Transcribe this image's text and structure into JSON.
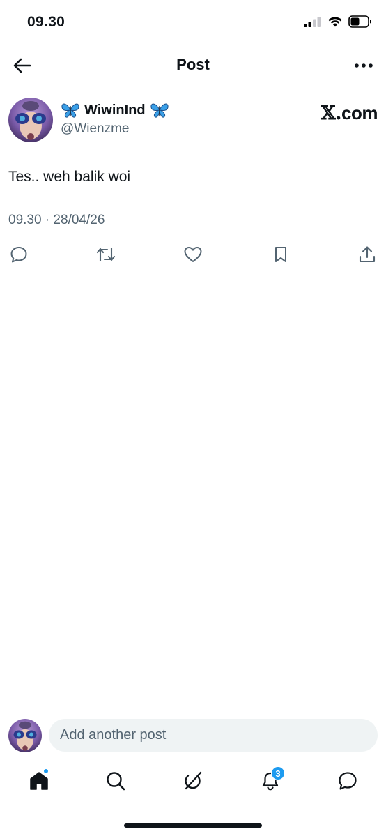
{
  "status_bar": {
    "time": "09.30"
  },
  "nav": {
    "title": "Post"
  },
  "post": {
    "author_name": "WiwinInd",
    "author_handle": "@Wienzme",
    "source_logo": "com",
    "source_logo_prefix": "𝕏.",
    "text": "Tes.. weh balik woi",
    "timestamp": "09.30 · 28/04/26"
  },
  "actions": [
    "reply-icon",
    "repost-icon",
    "like-icon",
    "bookmark-icon",
    "share-icon"
  ],
  "composer": {
    "placeholder": "Add another post"
  },
  "tabbar": {
    "items": [
      "home-icon",
      "search-icon",
      "grok-icon",
      "notifications-icon",
      "messages-icon"
    ],
    "notifications_badge": "3"
  },
  "colors": {
    "accent": "#1d9bf0",
    "text": "#0f1419",
    "secondary": "#536471",
    "input_bg": "#eff3f4"
  }
}
